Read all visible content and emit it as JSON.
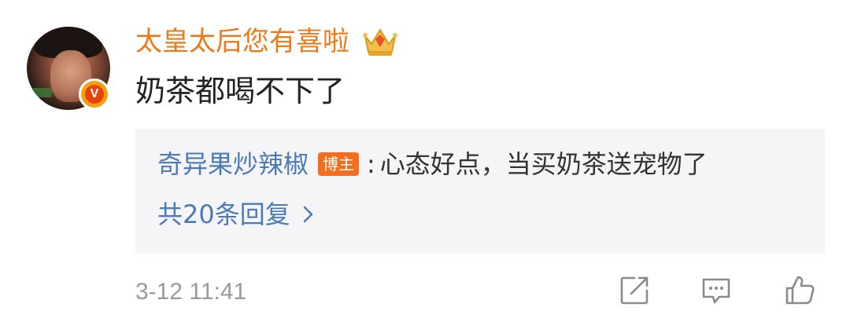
{
  "comment": {
    "username": "太皇太后您有喜啦",
    "text": "奶茶都喝不下了",
    "timestamp": "3-12 11:41",
    "verified_icon": "verified-v-badge",
    "member_icon": "crown-icon"
  },
  "reply_preview": {
    "author": "奇异果炒辣椒",
    "author_tag": "博主",
    "colon": ":",
    "text": "心态好点，当买奶茶送宠物了",
    "more_label": "共20条回复"
  },
  "colors": {
    "username": "#eb7a1a",
    "link_blue": "#4a7bb8",
    "author_tag_bg": "#f46d1f",
    "reply_bg": "#f5f5f7",
    "muted": "#9a9a9a"
  },
  "actions": [
    "share-icon",
    "comment-icon",
    "like-icon"
  ]
}
